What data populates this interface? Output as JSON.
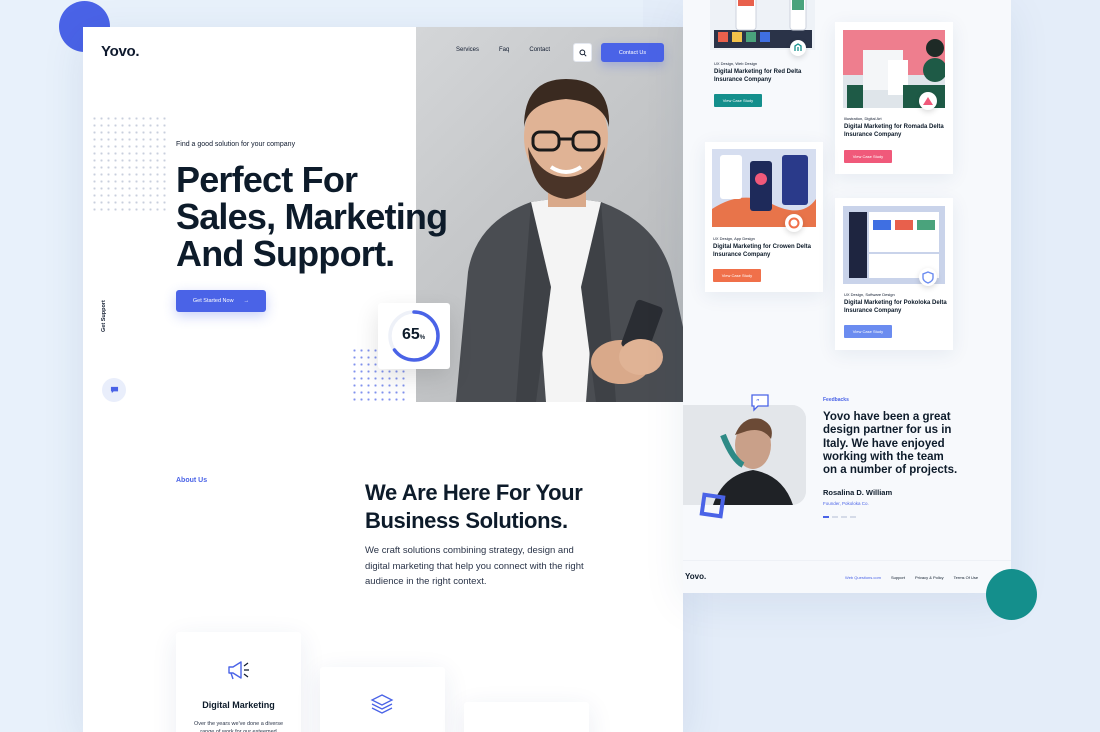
{
  "brand": {
    "name": "Yovo.",
    "accent": "#4a63e7",
    "secondary_accent": "#148f8c"
  },
  "nav": {
    "items": [
      "Services",
      "Faq",
      "Contact"
    ],
    "contact_label": "Contact Us",
    "search_icon": "search-icon"
  },
  "hero": {
    "kicker": "Find a good solution for your company",
    "title_lines": [
      "Perfect For",
      "Sales, Marketing",
      "And Support."
    ],
    "cta_label": "Get Started Now",
    "cta_arrow": "→",
    "progress_value": "65",
    "progress_unit": "%",
    "progress_fraction": 0.65
  },
  "support": {
    "label": "Get Support"
  },
  "about": {
    "label": "About Us",
    "title": "We Are Here For Your Business Solutions.",
    "body": "We craft solutions combining strategy, design and digital marketing that help you connect with the right audience in the right context."
  },
  "services": [
    {
      "title": "Digital Marketing",
      "body": "Over the years we've done a diverse range of work for our esteemed"
    },
    {
      "title": "",
      "body": ""
    },
    {
      "title": "",
      "body": ""
    }
  ],
  "case_studies": [
    {
      "tags": "UX Design, Web Design",
      "title": "Digital Marketing for Red Delta Insurance Company",
      "cta": "View Case Study",
      "cta_color": "#148f8c"
    },
    {
      "tags": "Illustration, Digital Art",
      "title": "Digital Marketing for Romada Delta Insurance Company",
      "cta": "View Case Study",
      "cta_color": "#f0597a"
    },
    {
      "tags": "UX Design, App Design",
      "title": "Digital Marketing for Crowen Delta Insurance Company",
      "cta": "View Case Study",
      "cta_color": "#f0704a"
    },
    {
      "tags": "UX Design, Software Design",
      "title": "Digital Marketing for Pokoloka Delta Insurance Company",
      "cta": "View Case Study",
      "cta_color": "#6b8cf0"
    }
  ],
  "feedback": {
    "label": "Feedbacks",
    "quote": "Yovo have been a great design partner for us in Italy. We have enjoyed working with the team on a number of projects.",
    "name": "Rosalina D. William",
    "role": "Founder, Pokoloka Co."
  },
  "footer": {
    "logo": "Yovo.",
    "links": [
      "Web Questions.com",
      "Support",
      "Privacy & Policy",
      "Terms Of Use"
    ]
  }
}
